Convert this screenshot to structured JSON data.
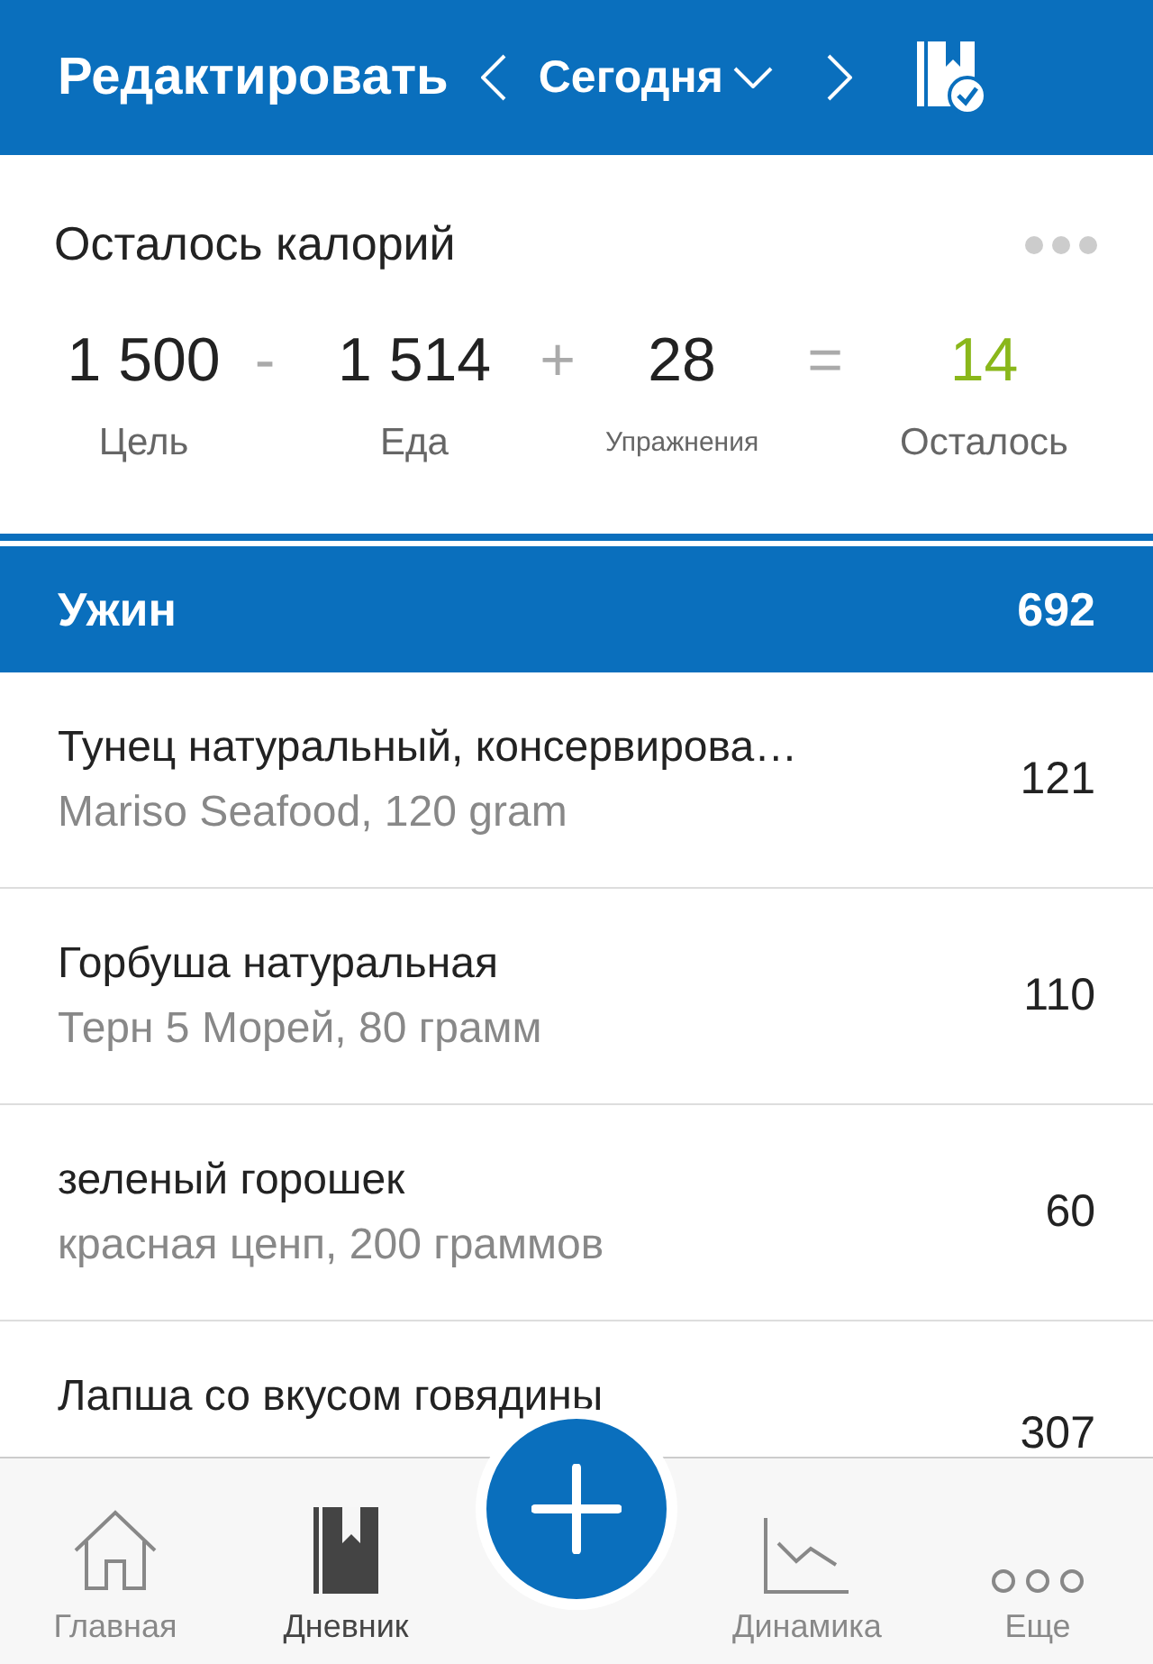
{
  "header": {
    "edit": "Редактировать",
    "date": "Сегодня"
  },
  "summary": {
    "title": "Осталось калорий",
    "items": [
      {
        "value": "1 500",
        "label": "Цель",
        "kind": "plain",
        "op": "-"
      },
      {
        "value": "1 514",
        "label": "Еда",
        "kind": "plain",
        "op": "+"
      },
      {
        "value": "28",
        "label": "Упражнения",
        "kind": "small",
        "op": "="
      },
      {
        "value": "14",
        "label": "Осталось",
        "kind": "result"
      }
    ]
  },
  "meal": {
    "name": "Ужин",
    "calories": "692",
    "foods": [
      {
        "name": "Тунец натуральный, консервирова…",
        "detail": "Mariso Seafood, 120 gram",
        "calories": "121"
      },
      {
        "name": "Горбуша натуральная",
        "detail": "Терн 5 Морей, 80 грамм",
        "calories": "110"
      },
      {
        "name": "зеленый горошек",
        "detail": "красная ценп, 200 граммов",
        "calories": "60"
      },
      {
        "name": "Лапша со вкусом говядины",
        "calories": "307"
      }
    ]
  },
  "tabbar": [
    {
      "label": "Главная",
      "kind": "home",
      "selected": false
    },
    {
      "label": "Дневник",
      "kind": "diary",
      "selected": true
    },
    {
      "kind": "add"
    },
    {
      "label": "Динамика",
      "kind": "chart",
      "selected": false
    },
    {
      "label": "Еще",
      "kind": "more",
      "selected": false
    }
  ]
}
